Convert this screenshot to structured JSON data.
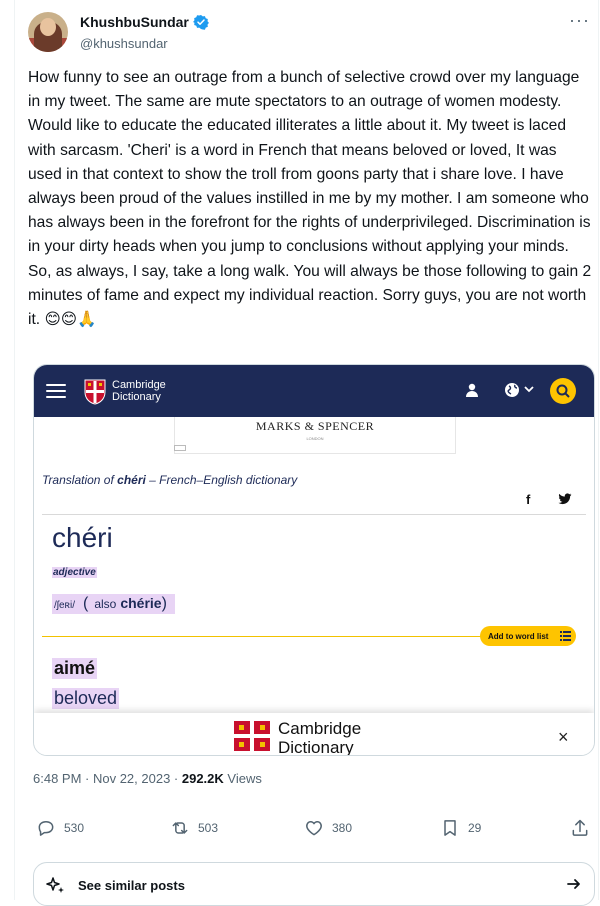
{
  "tweet": {
    "author_name": "KhushbuSundar",
    "handle": "@khushsundar",
    "more_icon": "more-dots-icon",
    "text": "How funny to see an outrage from a bunch of selective crowd over my language in my tweet. The same are mute spectators to an outrage of women modesty. Would like to educate the educated illiterates a little about it. My tweet is laced with sarcasm. 'Cheri' is a word in French that means beloved or loved,  It was used in that context to show the troll from goons party that i share love. I have always been proud of the values instilled in me by my mother. I am someone who has always been in the forefront for the rights of underprivileged. Discrimination is in your dirty heads when you jump to conclusions without applying your minds. So, as always, I say, take a long walk. You will always be those following to gain 2 minutes of fame and expect my individual reaction. Sorry guys, you are not worth it. 😊😊🙏",
    "timestamp": "6:48 PM · Nov 22, 2023 · ",
    "views_count": "292.2K",
    "views_label": " Views"
  },
  "image_card": {
    "logo_line1": "Cambridge",
    "logo_line2": "Dictionary",
    "ad_brand": "MARKS & SPENCER",
    "ad_sub": "LONDON",
    "translation_prefix": "Translation of ",
    "translation_word": "chéri",
    "translation_suffix": " – French–English dictionary",
    "share_facebook": "f",
    "headword": "chéri",
    "part_of_speech": "adjective",
    "pronunciation": "/ʃeʀi/",
    "paren_open": "(",
    "also_label": "also",
    "also_word": "chérie",
    "paren_close": ")",
    "add_to_list": "Add to word list",
    "translation": "aimé",
    "gloss": "beloved",
    "footer_line1": "Cambridge",
    "footer_line2": "Dictionary",
    "footer_close": "×"
  },
  "actions": {
    "replies": "530",
    "reposts": "503",
    "likes": "380",
    "bookmarks": "29"
  },
  "similar_posts": {
    "label": "See similar posts"
  },
  "colors": {
    "cambridge_navy": "#1d2a57",
    "cambridge_yellow": "#fec400",
    "highlight": "#e8d4f5",
    "verified_blue": "#1d9bf0",
    "muted_text": "#536471"
  }
}
